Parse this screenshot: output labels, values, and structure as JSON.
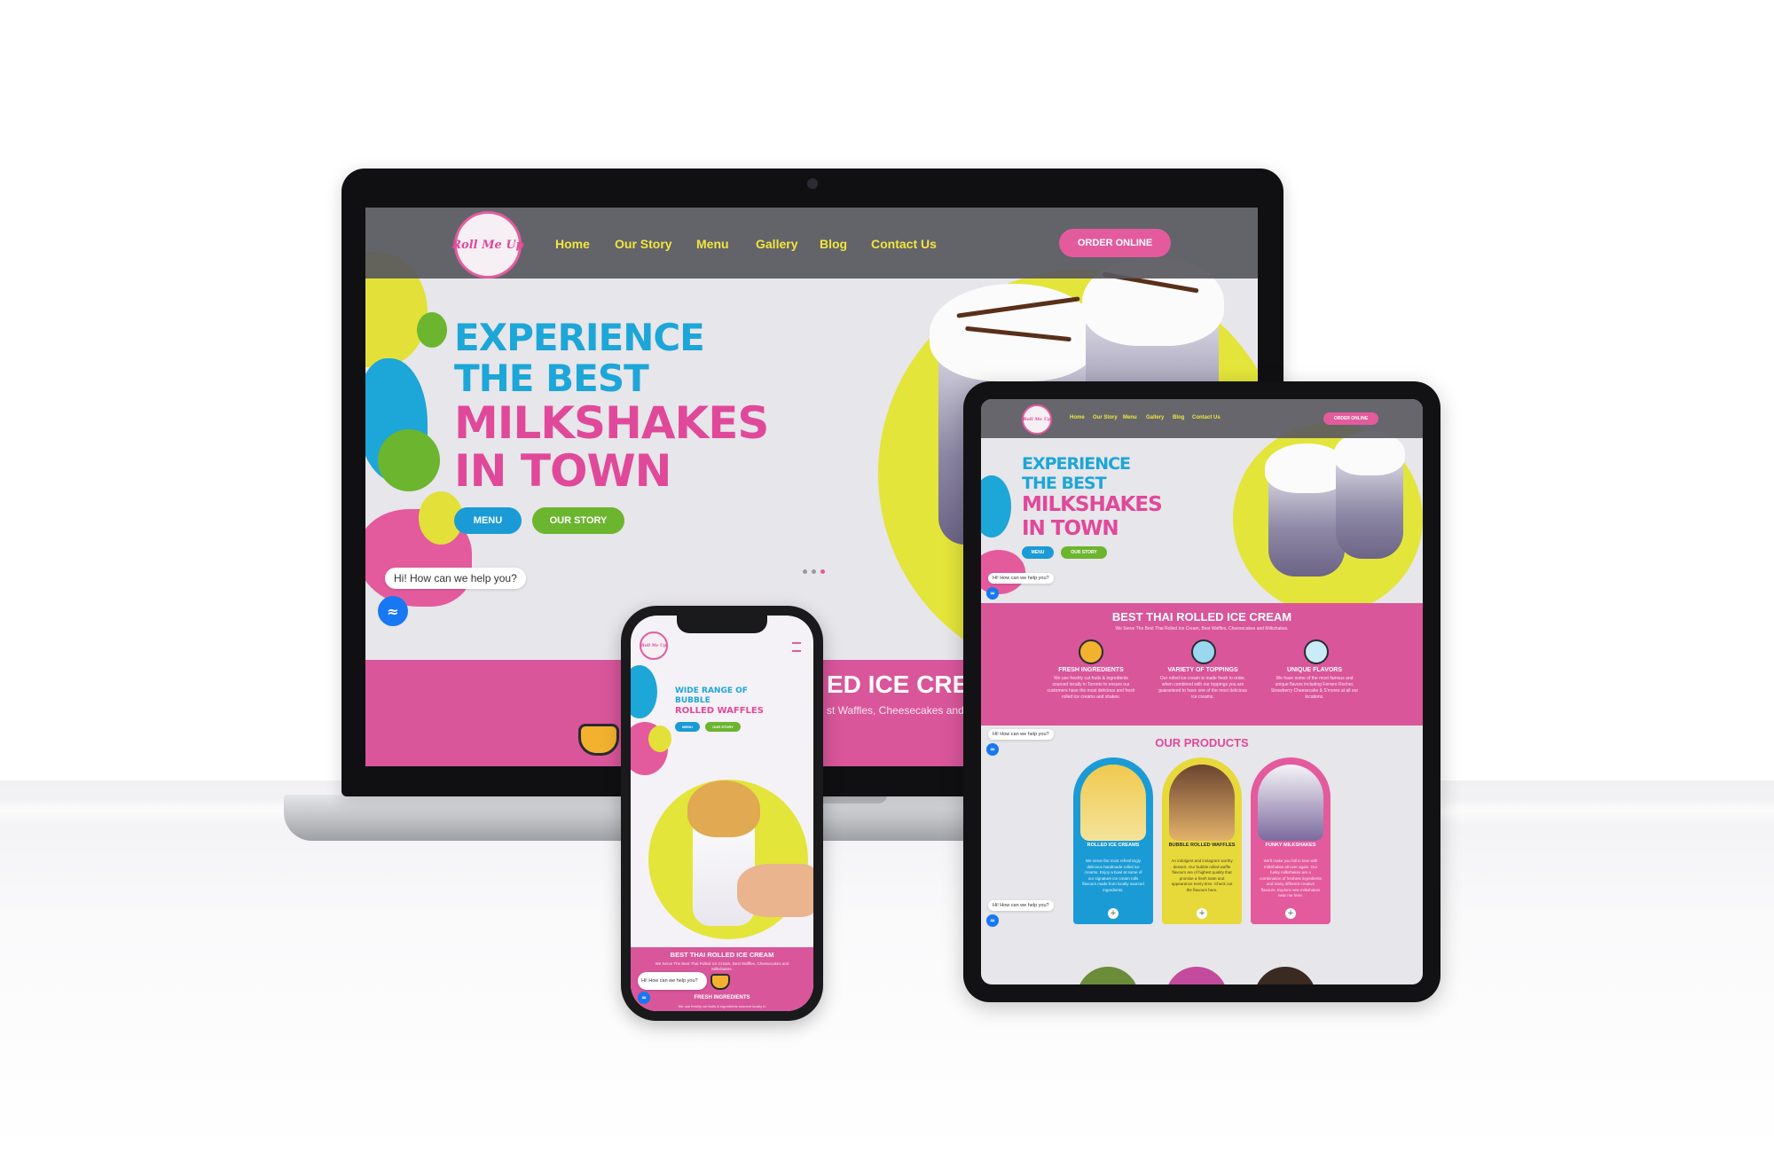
{
  "brand": {
    "logo_text": "Roll Me Up",
    "colors": {
      "pink": "#e45b9d",
      "yellow": "#f1e63e",
      "blue": "#1b9bd6",
      "green": "#6cb52f",
      "nav_bg": "#58585e"
    }
  },
  "nav": {
    "links": [
      "Home",
      "Our Story",
      "Menu",
      "Gallery",
      "Blog",
      "Contact Us"
    ],
    "order_button": "ORDER ONLINE",
    "menu_icon": "hamburger-icon"
  },
  "hero": {
    "line1": "EXPERIENCE",
    "line2": "THE BEST",
    "line3": "MILKSHAKES",
    "line4": "IN TOWN",
    "menu_button": "MENU",
    "story_button": "OUR STORY"
  },
  "chat": {
    "prompt": "Hi! How can we help you?",
    "prompt_short": "Hi! How can we help you?",
    "icon": "messenger-icon"
  },
  "laptop_band": {
    "title_partial": "ED ICE CRE",
    "subtitle_partial": "st Waffles, Cheesecakes and M"
  },
  "section": {
    "title": "BEST THAI ROLLED ICE CREAM",
    "subtitle": "We Serve The Best Thai Rolled Ice Cream, Best Waffles, Cheesecakes and Milkshakes."
  },
  "features": [
    {
      "title": "FRESH INGREDIENTS",
      "text": "We use freshly cut fruits & ingredients sourced locally in Toronto to ensure our customers have the most delicious and fresh rolled ice creams and shakes.",
      "icon": "fruit-bowl-icon"
    },
    {
      "title": "VARIETY OF TOPPINGS",
      "text": "Our rolled ice cream is made fresh to order, when combined with our toppings you are guaranteed to have one of the most delicious ice creams.",
      "icon": "sundae-icon"
    },
    {
      "title": "UNIQUE FLAVORS",
      "text": "We have some of the most famous and unique flavors including Ferrero Rocher, Strawberry Cheesecake & S'mores at all our locations.",
      "icon": "ice-cream-bowl-icon"
    }
  ],
  "products": {
    "title": "OUR PRODUCTS",
    "items": [
      {
        "name": "ROLLED ICE CREAMS",
        "desc": "We serve the most refreshingly delicious handmade rolled ice creams. Enjoy a bowl at some of our signature ice cream rolls flavours made from locally sourced ingredients.",
        "bg": "#1b9bd6"
      },
      {
        "name": "BUBBLE ROLLED WAFFLES",
        "desc": "An indulgent and instagram worthy dessert. Our bubble rolled waffle flavours are of highest quality that promise a fresh taste and appearance every time. Check out the flavours here.",
        "bg": "#e8d93a"
      },
      {
        "name": "FUNKY MILKSHAKES",
        "desc": "We'll make you fall in love with milkshakes all over again. Our funky milkshakes are a combination of freshest ingredients and many different creative flavours. Explore new milkshakes near me here.",
        "bg": "#e45b9d"
      }
    ]
  },
  "phone": {
    "hero_line1": "WIDE RANGE OF",
    "hero_line2": "BUBBLE",
    "hero_line3": "ROLLED WAFFLES",
    "menu_button": "MENU",
    "story_button": "OUR STORY",
    "section_title": "BEST THAI ROLLED ICE CREAM",
    "section_subtitle": "We Serve The Best Thai Rolled Ice Cream, Best Waffles, Cheesecakes and Milkshakes.",
    "feature_title": "FRESH INGREDIENTS",
    "feature_text": "We use freshly cut fruits & ingredients sourced locally in"
  }
}
